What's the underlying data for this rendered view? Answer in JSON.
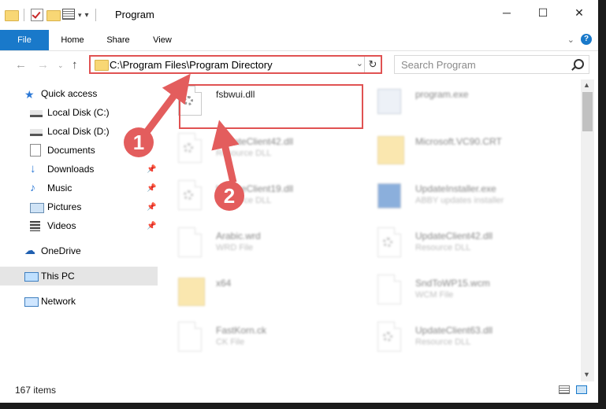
{
  "window": {
    "title": "Program",
    "controls": {
      "minimize": "─",
      "maximize": "☐",
      "close": "✕"
    }
  },
  "ribbon": {
    "tabs": [
      "File",
      "Home",
      "Share",
      "View"
    ],
    "help": "?"
  },
  "address": {
    "path": "C:\\Program Files\\Program Directory",
    "search_placeholder": "Search Program"
  },
  "nav": {
    "quick_access": "Quick access",
    "items": [
      "Local Disk (C:)",
      "Local Disk (D:)",
      "Documents",
      "Downloads",
      "Music",
      "Pictures",
      "Videos"
    ],
    "onedrive": "OneDrive",
    "this_pc": "This PC",
    "network": "Network"
  },
  "files": [
    {
      "name": "fsbwui.dll",
      "type": ""
    },
    {
      "name": "program.exe",
      "type": ""
    },
    {
      "name": "UpdateClient42.dll",
      "type": "Resource DLL"
    },
    {
      "name": "Microsoft.VC90.CRT",
      "type": ""
    },
    {
      "name": "UpdateClient19.dll",
      "type": "Resource DLL"
    },
    {
      "name": "UpdateInstaller.exe",
      "type": "ABBY updates installer"
    },
    {
      "name": "Arabic.wrd",
      "type": "WRD File"
    },
    {
      "name": "UpdateClient42.dll",
      "type": "Resource DLL"
    },
    {
      "name": "x64",
      "type": ""
    },
    {
      "name": "SndToWP15.wcm",
      "type": "WCM File"
    },
    {
      "name": "FastKorn.ck",
      "type": "CK File"
    },
    {
      "name": "UpdateClient63.dll",
      "type": "Resource DLL"
    }
  ],
  "status": {
    "count": "167 items"
  },
  "callouts": [
    "1",
    "2"
  ],
  "colors": {
    "accent": "#1979ca",
    "highlight": "#e05252"
  }
}
